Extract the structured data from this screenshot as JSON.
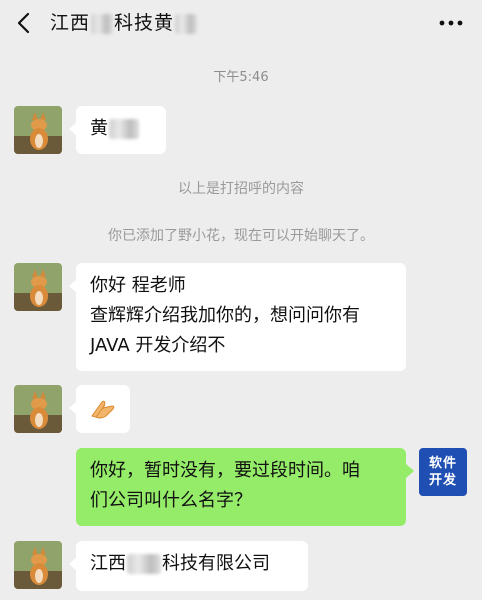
{
  "header": {
    "title_prefix": "江西",
    "title_suffix": "科技黄",
    "back_icon": "chevron-left-icon",
    "more_icon": "more-dots-icon"
  },
  "messages": {
    "time": "下午5:46",
    "greeting_name": "黄",
    "system_1": "以上是打招呼的内容",
    "system_2": "你已添加了野小花，现在可以开始聊天了。",
    "msg1_line1": "你好  程老师",
    "msg1_line2": "查辉辉介绍我加你的，想问问你有",
    "msg1_line3": "JAVA 开发介绍不",
    "msg2_icon": "handshake-icon",
    "msg3_line1": "你好，暂时没有，要过段时间。咱",
    "msg3_line2": "们公司叫什么名字？",
    "msg4_prefix": "江西",
    "msg4_suffix": "科技有限公司"
  },
  "self_avatar": {
    "line1": "软件",
    "line2": "开发",
    "color": "#1f4fb3"
  },
  "colors": {
    "background": "#ededed",
    "bubble_in": "#ffffff",
    "bubble_out": "#95ec69"
  }
}
